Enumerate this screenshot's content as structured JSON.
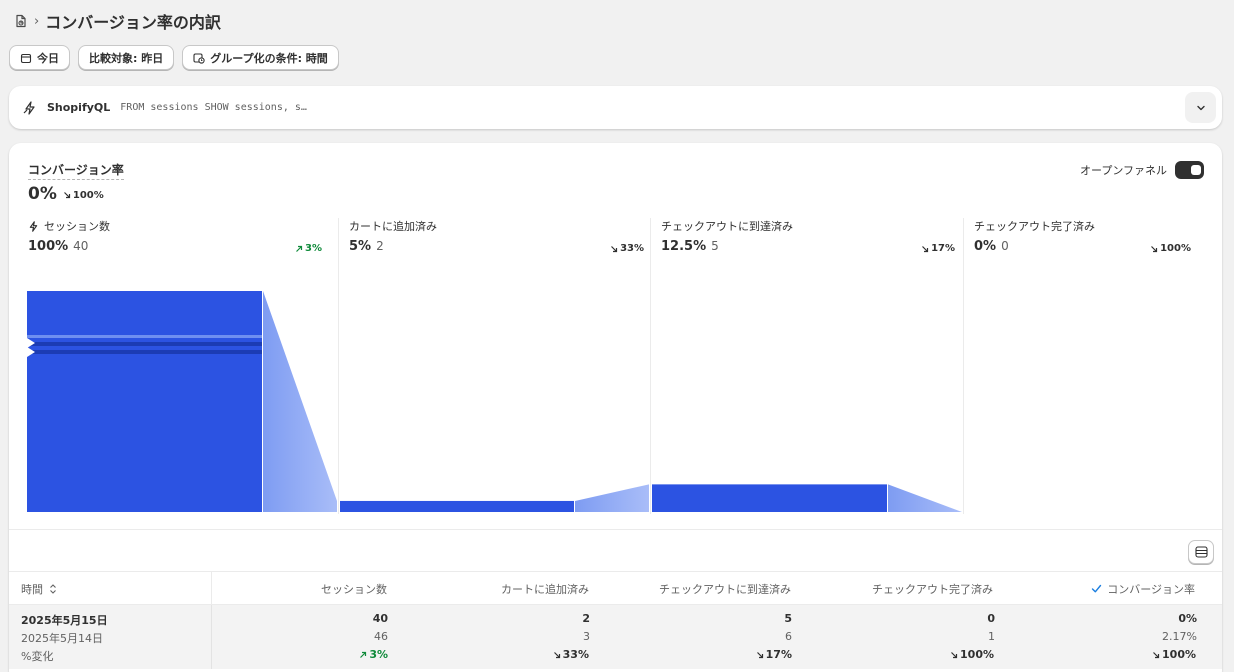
{
  "header": {
    "title": "コンバージョン率の内訳",
    "separator": "›"
  },
  "filters": {
    "date": "今日",
    "compare": "比較対象: 昨日",
    "group": "グループ化の条件: 時間"
  },
  "shopifyql": {
    "label": "ShopifyQL",
    "query": "FROM sessions SHOW sessions, s…"
  },
  "summary": {
    "label": "コンバージョン率",
    "value": "0%",
    "delta": "100%",
    "delta_dir": "down"
  },
  "toggle": {
    "label": "オープンファネル",
    "on": true
  },
  "funnel": {
    "stages": [
      {
        "name": "セッション数",
        "pct": "100%",
        "count": "40",
        "delta": "3%",
        "delta_dir": "up"
      },
      {
        "name": "カートに追加済み",
        "pct": "5%",
        "count": "2",
        "delta": "33%",
        "delta_dir": "down"
      },
      {
        "name": "チェックアウトに到達済み",
        "pct": "12.5%",
        "count": "5",
        "delta": "17%",
        "delta_dir": "down"
      },
      {
        "name": "チェックアウト完了済み",
        "pct": "0%",
        "count": "0",
        "delta": "100%",
        "delta_dir": "down"
      }
    ]
  },
  "table": {
    "columns": [
      "時間",
      "セッション数",
      "カートに追加済み",
      "チェックアウトに到達済み",
      "チェックアウト完了済み",
      "コンバージョン率"
    ],
    "rows": [
      {
        "current": [
          "2025年5月15日",
          "40",
          "2",
          "5",
          "0",
          "0%"
        ],
        "previous": [
          "2025年5月14日",
          "46",
          "3",
          "6",
          "1",
          "2.17%"
        ],
        "change_label": "%変化",
        "change": [
          {
            "v": "3%",
            "dir": "up"
          },
          {
            "v": "33%",
            "dir": "down"
          },
          {
            "v": "17%",
            "dir": "down"
          },
          {
            "v": "100%",
            "dir": "down"
          },
          {
            "v": "100%",
            "dir": "down"
          }
        ]
      }
    ]
  },
  "colors": {
    "bar": "#2c53e2",
    "connector_light": "#a9bdf8",
    "up": "#0f8a3a",
    "down": "#303030"
  },
  "icons": {
    "header": "document-chart-icon",
    "date": "calendar-icon",
    "group": "calendar-clock-icon",
    "ql": "lightning-icon",
    "expand": "chevron-down-icon",
    "table": "table-view-icon",
    "sort": "sort-icon",
    "check": "checkmark-icon"
  }
}
